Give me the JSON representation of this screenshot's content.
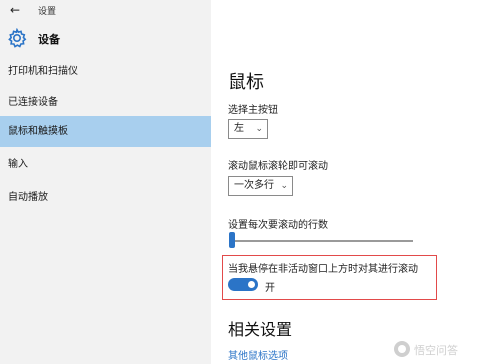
{
  "window": {
    "title": "设置",
    "back_glyph": "←"
  },
  "header": {
    "title": "设备",
    "icon": "gear-icon"
  },
  "sidebar": {
    "items": [
      {
        "label": "打印机和扫描仪",
        "selected": false
      },
      {
        "label": "已连接设备",
        "selected": false
      },
      {
        "label": "鼠标和触摸板",
        "selected": true
      },
      {
        "label": "输入",
        "selected": false
      },
      {
        "label": "自动播放",
        "selected": false
      }
    ]
  },
  "main": {
    "section_title": "鼠标",
    "primary_button": {
      "label": "选择主按钮",
      "value": "左"
    },
    "scroll_mode": {
      "label": "滚动鼠标滚轮即可滚动",
      "value": "一次多行"
    },
    "lines_to_scroll": {
      "label": "设置每次要滚动的行数",
      "level_fraction": 0.0
    },
    "inactive_scroll": {
      "label": "当我悬停在非活动窗口上方时对其进行滚动",
      "toggle_label": "开",
      "on": true
    },
    "related_title": "相关设置",
    "related_link": "其他鼠标选项"
  },
  "watermark": {
    "text": "悟空问答"
  },
  "colors": {
    "accent": "#2b74c7",
    "selected_bg": "#a8cfee",
    "highlight_border": "#e24a4a"
  }
}
